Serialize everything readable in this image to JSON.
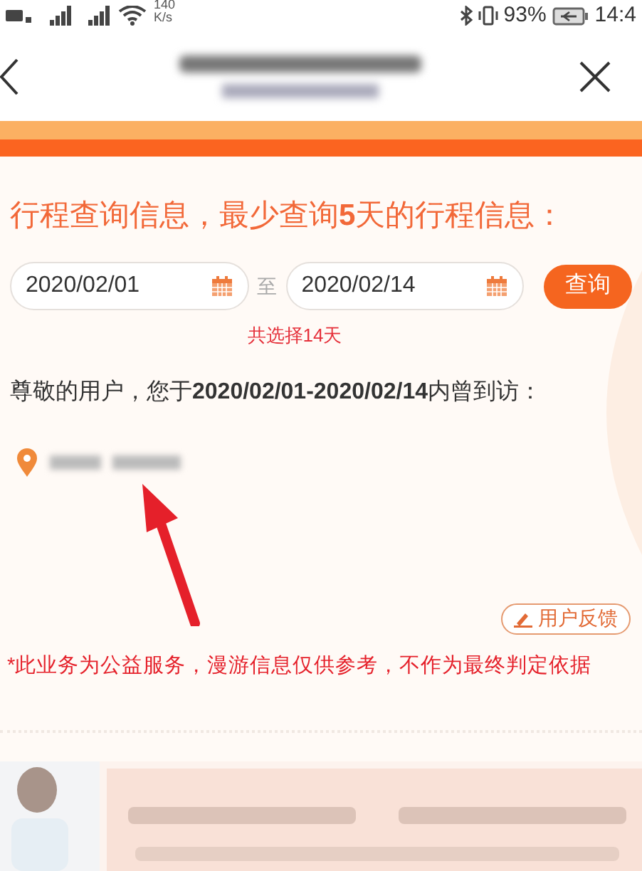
{
  "status_bar": {
    "speed": "140",
    "speed_unit": "K/s",
    "battery": "93%",
    "time": "14:4"
  },
  "nav": {
    "redacted_title": true
  },
  "heading": "行程查询信息，最少查询**5**天的行程信息：",
  "date_range": {
    "start": "2020/02/01",
    "separator": "至",
    "end": "2020/02/14",
    "button": "查询",
    "summary": "共选择14天"
  },
  "greeting": "尊敬的用户，您于**2020/02/01-2020/02/14**内曾到访：",
  "places": [
    {
      "redacted": true
    }
  ],
  "feedback_button": "用户反馈",
  "disclaimer": "*此业务为公益服务，漫游信息仅供参考，不作为最终判定依据"
}
